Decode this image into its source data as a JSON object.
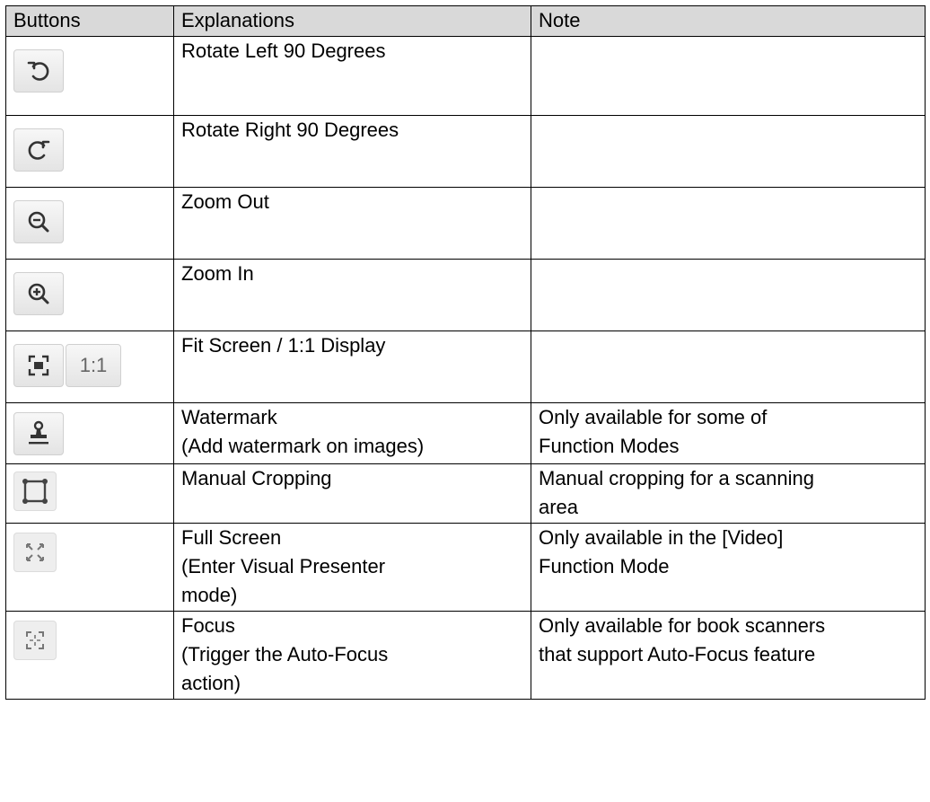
{
  "table": {
    "headers": {
      "buttons": "Buttons",
      "explanations": "Explanations",
      "note": "Note"
    },
    "rows": [
      {
        "icon": "rotate-left-icon",
        "explanation": "Rotate Left 90 Degrees",
        "note": ""
      },
      {
        "icon": "rotate-right-icon",
        "explanation": "Rotate Right 90 Degrees",
        "note": ""
      },
      {
        "icon": "zoom-out-icon",
        "explanation": "Zoom Out",
        "note": ""
      },
      {
        "icon": "zoom-in-icon",
        "explanation": "Zoom In",
        "note": ""
      },
      {
        "icon": "fit-screen-icon",
        "icon_text": "1:1",
        "explanation": "Fit Screen / 1:1 Display",
        "note": ""
      },
      {
        "icon": "watermark-stamp-icon",
        "explanation": "Watermark\n(Add watermark on images)",
        "note": "Only available for some of\nFunction Modes"
      },
      {
        "icon": "manual-crop-icon",
        "explanation": "Manual Cropping",
        "note": "Manual cropping for a scanning\narea"
      },
      {
        "icon": "full-screen-icon",
        "explanation": "Full Screen\n(Enter Visual Presenter\nmode)",
        "note": "Only available in the [Video]\nFunction Mode"
      },
      {
        "icon": "focus-icon",
        "explanation": "Focus\n(Trigger the Auto-Focus\naction)",
        "note": "Only available for book scanners\nthat support Auto-Focus feature"
      }
    ]
  }
}
